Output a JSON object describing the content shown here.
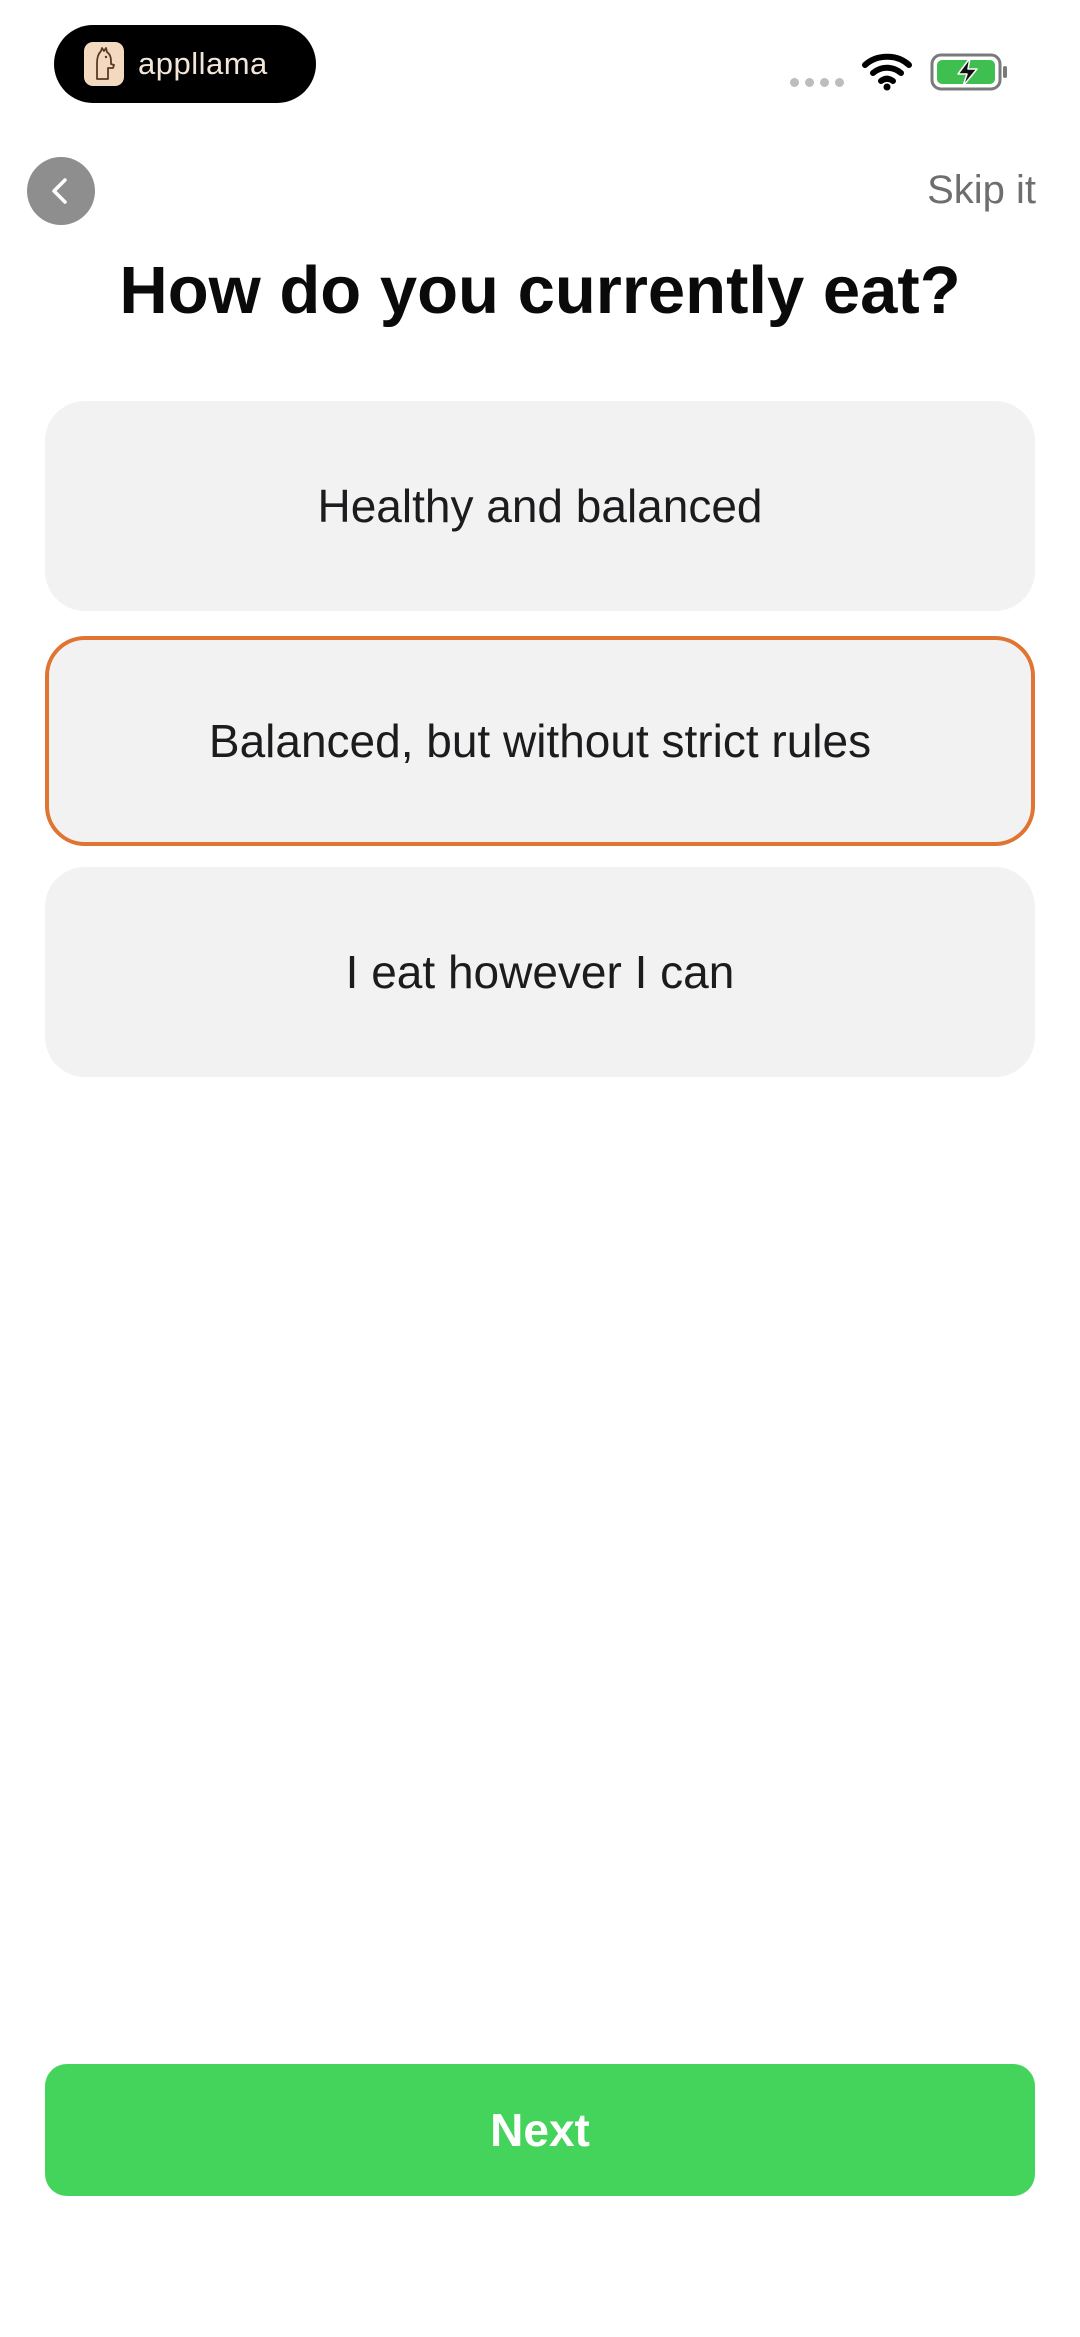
{
  "status_bar": {
    "brand_name": "appllama",
    "brand_icon": "llama-icon",
    "wifi_icon": "wifi-icon",
    "battery_icon": "battery-charging-icon",
    "battery_color": "#3fbf4f"
  },
  "header": {
    "back_icon": "chevron-left-icon",
    "skip_label": "Skip it"
  },
  "question": {
    "title": "How do you currently eat?"
  },
  "options": [
    {
      "label": "Healthy and balanced",
      "selected": false
    },
    {
      "label": "Balanced, but without strict rules",
      "selected": true
    },
    {
      "label": "I eat however I can",
      "selected": false
    }
  ],
  "footer": {
    "next_label": "Next"
  },
  "colors": {
    "accent_selected": "#e07432",
    "primary_button": "#44d35b",
    "option_background": "#f2f2f2"
  }
}
